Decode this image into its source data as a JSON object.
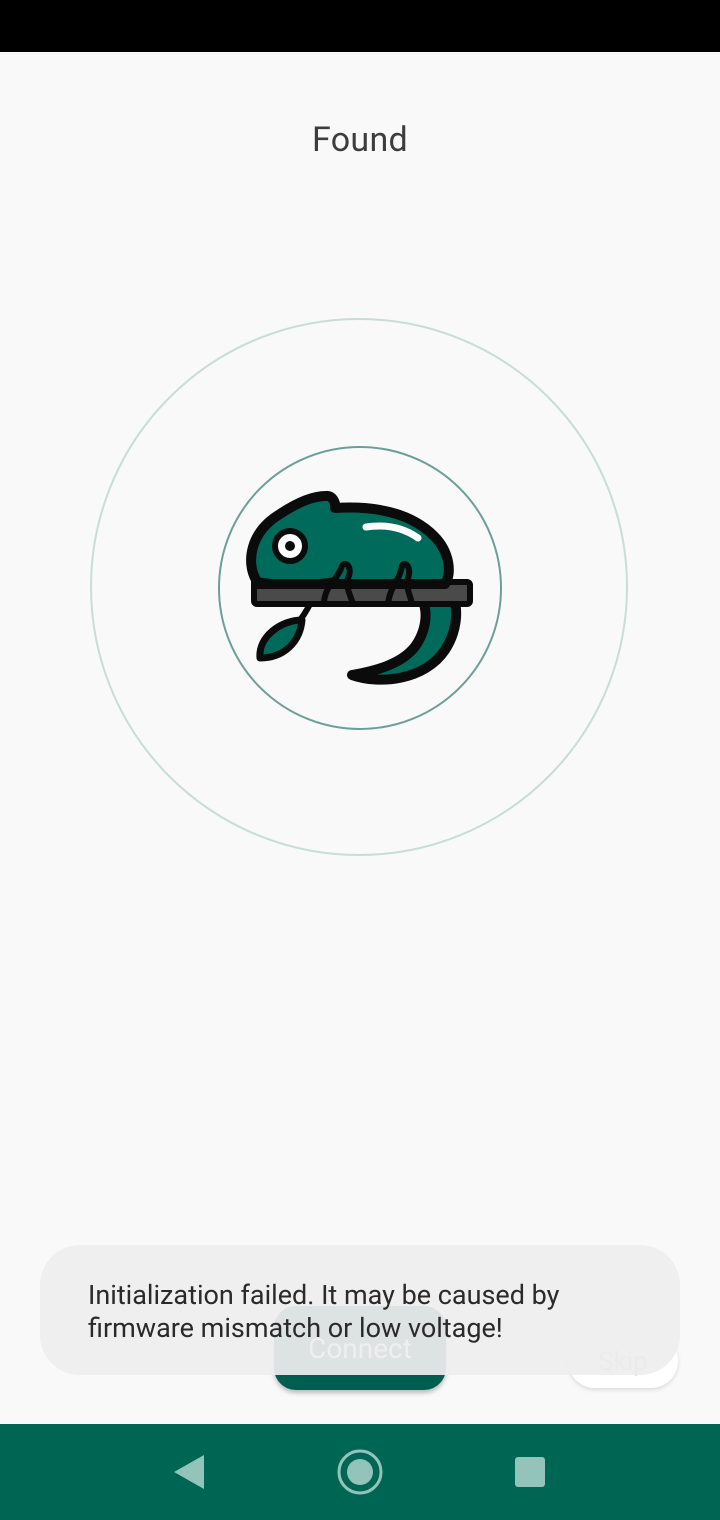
{
  "header": {
    "title": "Found"
  },
  "actions": {
    "connect_label": "Connect",
    "skip_label": "Skip"
  },
  "toast": {
    "message": "Initialization failed. It may be caused by firmware mismatch or low voltage!"
  },
  "device": {
    "icon": "chameleon-icon"
  },
  "navigation": {
    "back_icon": "back-icon",
    "home_icon": "home-icon",
    "recents_icon": "recents-icon"
  },
  "colors": {
    "accent": "#005e50",
    "nav_bar": "#006654",
    "chameleon_green": "#006b5a"
  }
}
